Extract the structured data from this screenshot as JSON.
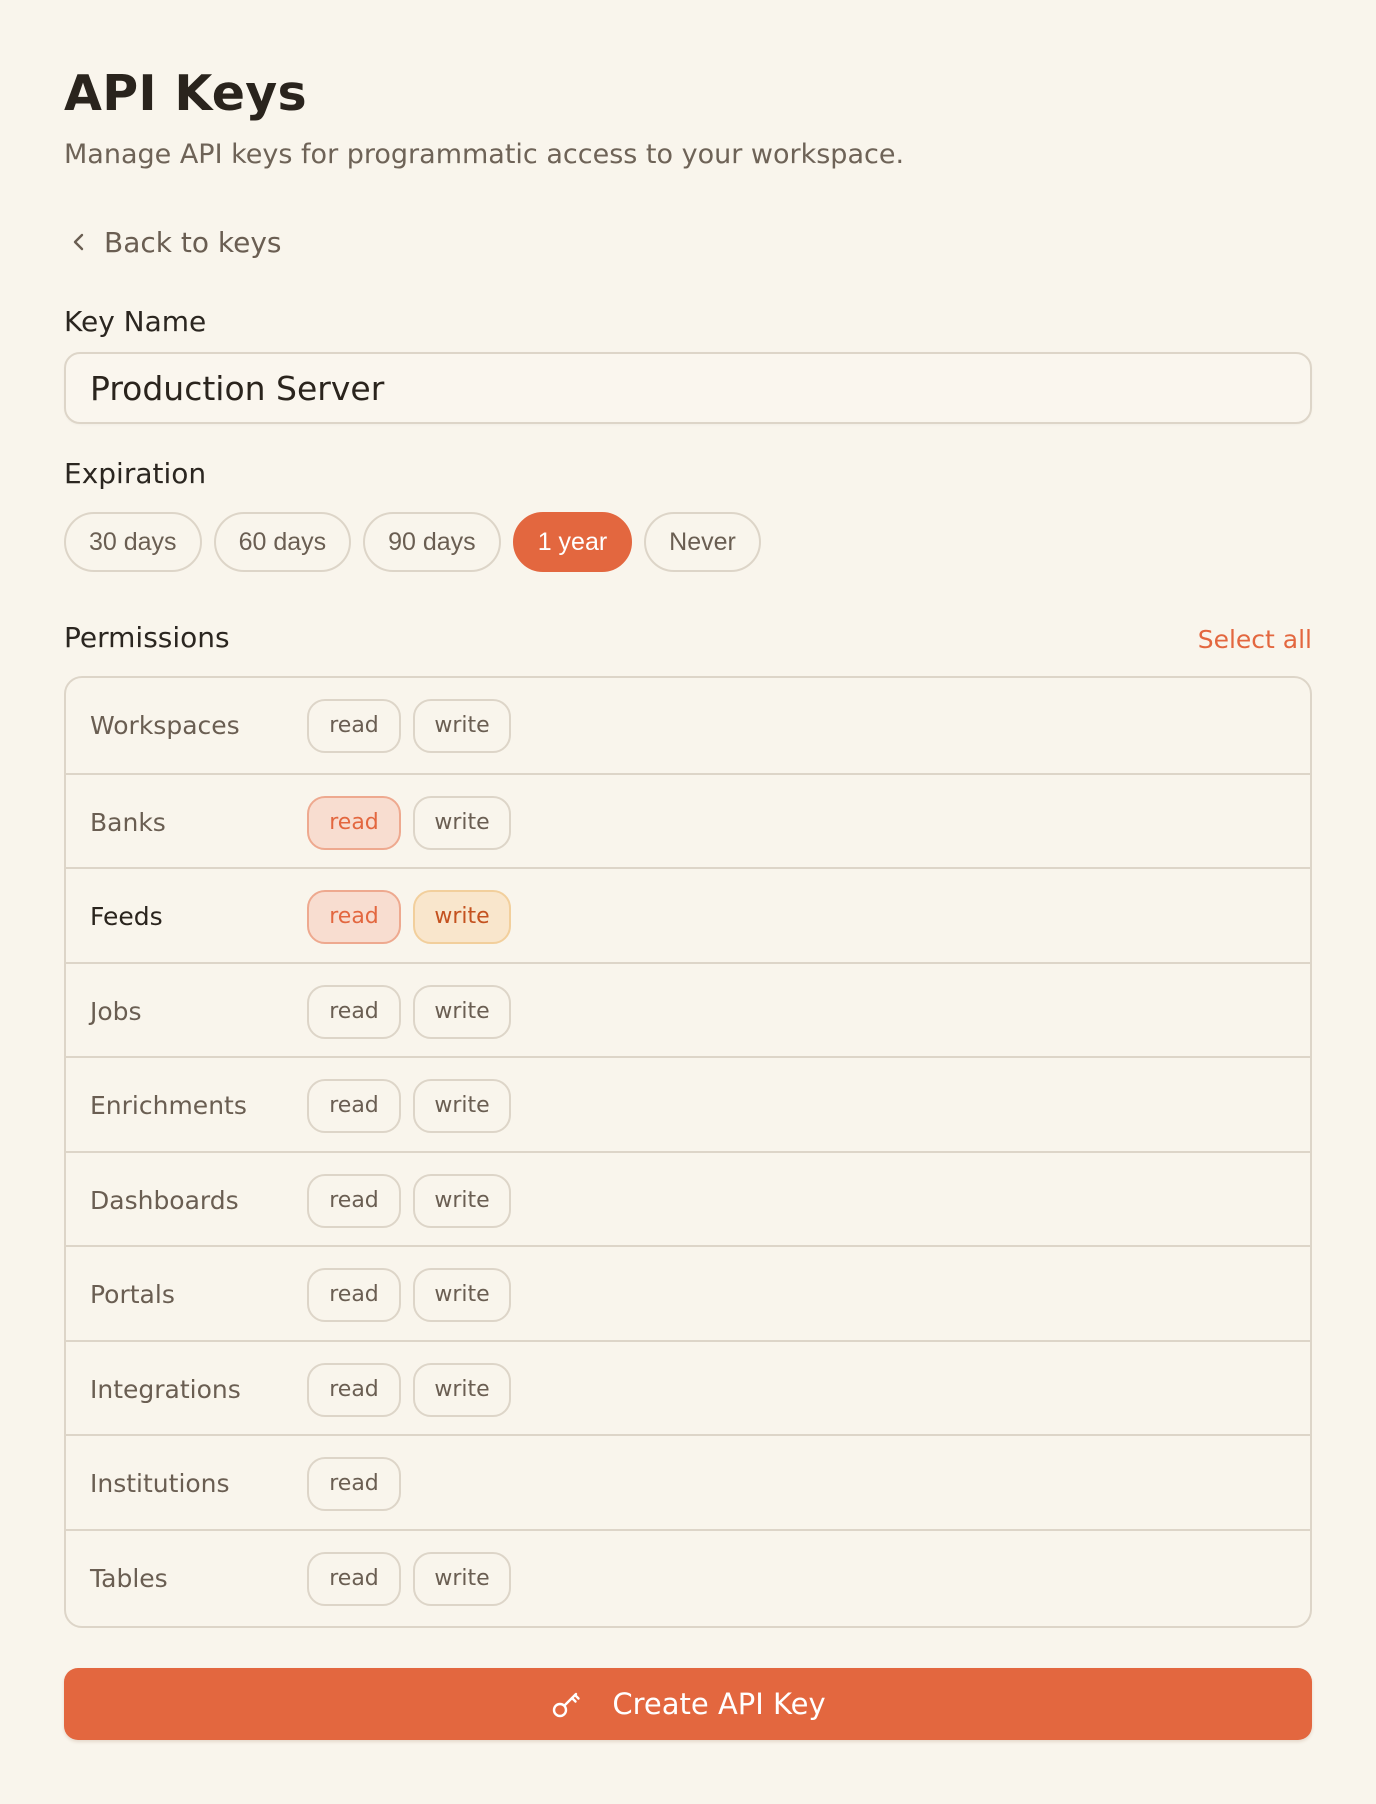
{
  "header": {
    "title": "API Keys",
    "subtitle": "Manage API keys for programmatic access to your workspace."
  },
  "back_link": {
    "label": "Back to keys",
    "icon": "chevron-left-icon"
  },
  "key_name": {
    "label": "Key Name",
    "value": "Production Server"
  },
  "expiration": {
    "label": "Expiration",
    "options": [
      "30 days",
      "60 days",
      "90 days",
      "1 year",
      "Never"
    ],
    "selected": "1 year"
  },
  "permissions": {
    "label": "Permissions",
    "select_all": "Select all",
    "rows": [
      {
        "name": "Workspaces",
        "read": "read",
        "write": "write",
        "read_on": false,
        "write_on": false
      },
      {
        "name": "Banks",
        "read": "read",
        "write": "write",
        "read_on": true,
        "write_on": false
      },
      {
        "name": "Feeds",
        "read": "read",
        "write": "write",
        "read_on": true,
        "write_on": true
      },
      {
        "name": "Jobs",
        "read": "read",
        "write": "write",
        "read_on": false,
        "write_on": false
      },
      {
        "name": "Enrichments",
        "read": "read",
        "write": "write",
        "read_on": false,
        "write_on": false
      },
      {
        "name": "Dashboards",
        "read": "read",
        "write": "write",
        "read_on": false,
        "write_on": false
      },
      {
        "name": "Portals",
        "read": "read",
        "write": "write",
        "read_on": false,
        "write_on": false
      },
      {
        "name": "Integrations",
        "read": "read",
        "write": "write",
        "read_on": false,
        "write_on": false
      },
      {
        "name": "Institutions",
        "read": "read",
        "read_on": false
      },
      {
        "name": "Tables",
        "read": "read",
        "write": "write",
        "read_on": false,
        "write_on": false
      }
    ]
  },
  "create_button": {
    "label": "Create API Key",
    "icon": "key-icon"
  },
  "colors": {
    "background": "#f9f5ec",
    "accent": "#e3673f",
    "border": "#ddd5c8",
    "read_selected_bg": "#f8ddd0",
    "write_selected_bg": "#f9e6cc"
  }
}
